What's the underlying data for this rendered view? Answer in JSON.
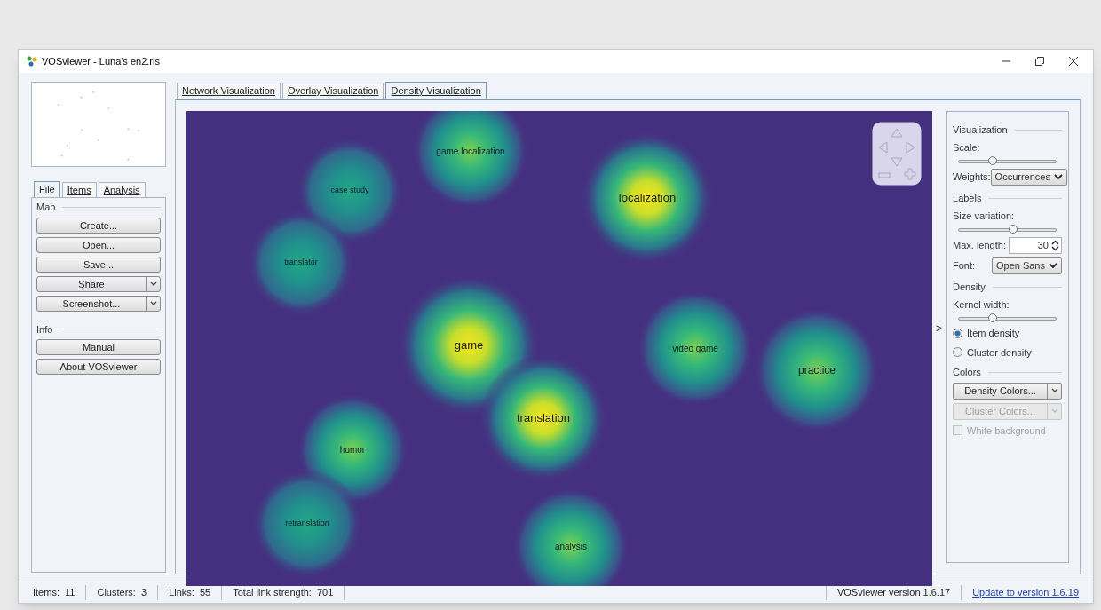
{
  "window": {
    "title": "VOSviewer - Luna's en2.ris"
  },
  "left_tabs": [
    {
      "label": "File",
      "selected": true
    },
    {
      "label": "Items",
      "selected": false
    },
    {
      "label": "Analysis",
      "selected": false
    }
  ],
  "map_section": {
    "title": "Map",
    "buttons": [
      {
        "label": "Create...",
        "kind": "plain"
      },
      {
        "label": "Open...",
        "kind": "plain"
      },
      {
        "label": "Save...",
        "kind": "plain"
      },
      {
        "label": "Share",
        "kind": "split"
      },
      {
        "label": "Screenshot...",
        "kind": "split"
      }
    ]
  },
  "info_section": {
    "title": "Info",
    "buttons": [
      {
        "label": "Manual",
        "kind": "plain"
      },
      {
        "label": "About VOSviewer",
        "kind": "plain"
      }
    ]
  },
  "main_tabs": [
    {
      "label": "Network Visualization",
      "selected": false
    },
    {
      "label": "Overlay Visualization",
      "selected": false
    },
    {
      "label": "Density Visualization",
      "selected": true
    }
  ],
  "items": [
    {
      "label": "game localization"
    },
    {
      "label": "case study"
    },
    {
      "label": "localization"
    },
    {
      "label": "translator"
    },
    {
      "label": "game"
    },
    {
      "label": "video game"
    },
    {
      "label": "practice"
    },
    {
      "label": "translation"
    },
    {
      "label": "humor"
    },
    {
      "label": "retranslation"
    },
    {
      "label": "analysis"
    }
  ],
  "expand_arrow": ">",
  "visualization": {
    "title": "Visualization",
    "scale_label": "Scale:",
    "scale": {
      "level": 0.35
    },
    "weights_label": "Weights:",
    "weights_value": "Occurrences"
  },
  "labels": {
    "title": "Labels",
    "size_variation_label": "Size variation:",
    "size_variation": {
      "level": 0.56
    },
    "max_length_label": "Max. length:",
    "max_length_value": "30",
    "font_label": "Font:",
    "font_value": "Open Sans"
  },
  "density": {
    "title": "Density",
    "kernel_width_label": "Kernel width:",
    "kernel_width": {
      "level": 0.35
    },
    "options": [
      {
        "label": "Item density",
        "selected": true
      },
      {
        "label": "Cluster density",
        "selected": false
      }
    ]
  },
  "colors": {
    "title": "Colors",
    "buttons": [
      {
        "label": "Density Colors...",
        "disabled": false
      },
      {
        "label": "Cluster Colors...",
        "disabled": true
      }
    ],
    "white_background": {
      "label": "White background",
      "checked": false,
      "disabled": true
    }
  },
  "status_bar": {
    "left": [
      "Items:  11",
      "Clusters:  3",
      "Links:  55",
      "Total link strength:  701"
    ],
    "version": "VOSviewer version 1.6.17",
    "update_link": "Update to version 1.6.19"
  }
}
